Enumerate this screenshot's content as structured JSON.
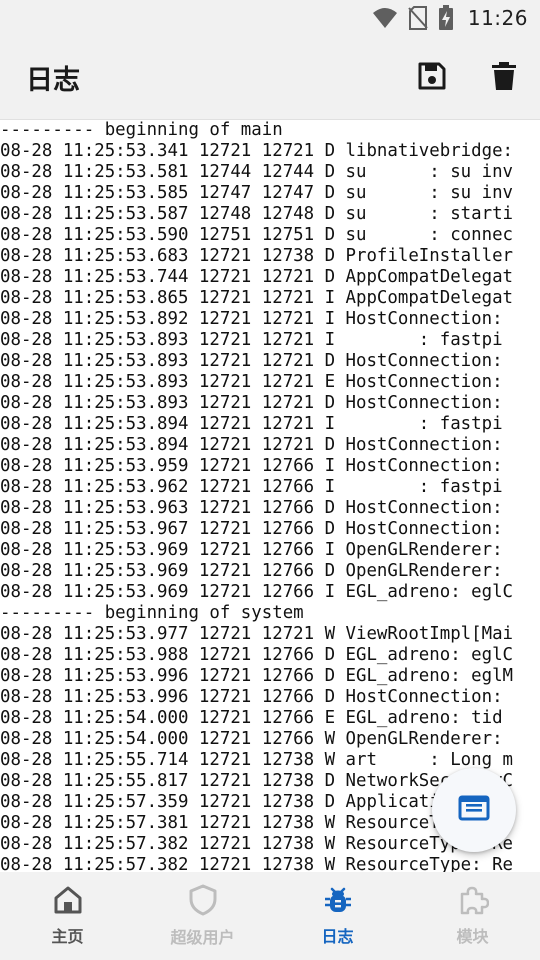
{
  "status_bar": {
    "time": "11:26",
    "icons": [
      "wifi-icon",
      "no-sim-icon",
      "battery-charging-icon"
    ]
  },
  "app_bar": {
    "title": "日志",
    "actions": [
      "save-icon",
      "delete-icon"
    ]
  },
  "log_lines": [
    "--------- beginning of main",
    "08-28 11:25:53.341 12721 12721 D libnativebridge:",
    "08-28 11:25:53.581 12744 12744 D su      : su inv",
    "08-28 11:25:53.585 12747 12747 D su      : su inv",
    "08-28 11:25:53.587 12748 12748 D su      : starti",
    "08-28 11:25:53.590 12751 12751 D su      : connec",
    "08-28 11:25:53.683 12721 12738 D ProfileInstaller",
    "08-28 11:25:53.744 12721 12721 D AppCompatDelegat",
    "08-28 11:25:53.865 12721 12721 I AppCompatDelegat",
    "08-28 11:25:53.892 12721 12721 I HostConnection:",
    "08-28 11:25:53.893 12721 12721 I        : fastpi",
    "08-28 11:25:53.893 12721 12721 D HostConnection:",
    "08-28 11:25:53.893 12721 12721 E HostConnection:",
    "08-28 11:25:53.893 12721 12721 D HostConnection:",
    "08-28 11:25:53.894 12721 12721 I        : fastpi",
    "08-28 11:25:53.894 12721 12721 D HostConnection:",
    "08-28 11:25:53.959 12721 12766 I HostConnection:",
    "08-28 11:25:53.962 12721 12766 I        : fastpi",
    "08-28 11:25:53.963 12721 12766 D HostConnection:",
    "08-28 11:25:53.967 12721 12766 D HostConnection:",
    "08-28 11:25:53.969 12721 12766 I OpenGLRenderer:",
    "08-28 11:25:53.969 12721 12766 D OpenGLRenderer:",
    "08-28 11:25:53.969 12721 12766 I EGL_adreno: eglC",
    "--------- beginning of system",
    "08-28 11:25:53.977 12721 12721 W ViewRootImpl[Mai",
    "08-28 11:25:53.988 12721 12766 D EGL_adreno: eglC",
    "08-28 11:25:53.996 12721 12766 D EGL_adreno: eglM",
    "08-28 11:25:53.996 12721 12766 D HostConnection:",
    "08-28 11:25:54.000 12721 12766 E EGL_adreno: tid",
    "08-28 11:25:54.000 12721 12766 W OpenGLRenderer:",
    "08-28 11:25:55.714 12721 12738 W art     : Long m",
    "08-28 11:25:55.817 12721 12738 D NetworkSecurityC",
    "08-28 11:25:57.359 12721 12738 D ApplicationLoade",
    "08-28 11:25:57.381 12721 12738 W ResourceType: Re",
    "08-28 11:25:57.382 12721 12738 W ResourceType: Re",
    "08-28 11:25:57.382 12721 12738 W ResourceType: Re"
  ],
  "fab": {
    "icon": "log-file-icon"
  },
  "bottom_nav": [
    {
      "label": "主页",
      "icon": "home-icon",
      "state": "normal"
    },
    {
      "label": "超级用户",
      "icon": "shield-icon",
      "state": "disabled"
    },
    {
      "label": "日志",
      "icon": "bug-icon",
      "state": "active"
    },
    {
      "label": "模块",
      "icon": "puzzle-icon",
      "state": "disabled"
    }
  ],
  "colors": {
    "accent": "#1565c0",
    "disabled": "#bdbdbd",
    "bar_bg": "#f1f1f1"
  }
}
